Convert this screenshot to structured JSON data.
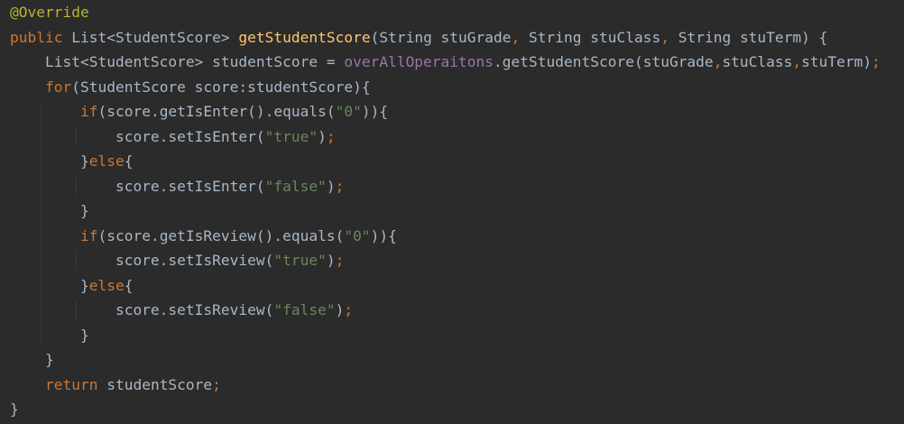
{
  "colors": {
    "background": "#2b2b2b",
    "default_text": "#a9b7c6",
    "keyword": "#cc7832",
    "annotation": "#bbb529",
    "method_declaration": "#ffc66d",
    "field": "#9876aa",
    "string": "#6a8759",
    "indent_guide": "#393939"
  },
  "code": {
    "lines": [
      {
        "tokens": [
          {
            "t": "@Override",
            "k": "annotation"
          }
        ]
      },
      {
        "tokens": [
          {
            "t": "public",
            "k": "keyword"
          },
          {
            "t": " List<StudentScore> ",
            "k": "plain"
          },
          {
            "t": "getStudentScore",
            "k": "method-decl"
          },
          {
            "t": "(String stuGrade",
            "k": "plain"
          },
          {
            "t": ", ",
            "k": "keyword"
          },
          {
            "t": "String stuClass",
            "k": "plain"
          },
          {
            "t": ", ",
            "k": "keyword"
          },
          {
            "t": "String stuTerm) {",
            "k": "plain"
          }
        ]
      },
      {
        "tokens": [
          {
            "t": "    List<StudentScore> studentScore = ",
            "k": "plain"
          },
          {
            "t": "overAllOperaitons",
            "k": "field"
          },
          {
            "t": ".getStudentScore(stuGrade",
            "k": "plain"
          },
          {
            "t": ",",
            "k": "keyword"
          },
          {
            "t": "stuClass",
            "k": "plain"
          },
          {
            "t": ",",
            "k": "keyword"
          },
          {
            "t": "stuTerm)",
            "k": "plain"
          },
          {
            "t": ";",
            "k": "keyword"
          }
        ]
      },
      {
        "tokens": [
          {
            "t": "    ",
            "k": "plain"
          },
          {
            "t": "for",
            "k": "keyword"
          },
          {
            "t": "(StudentScore score:studentScore){",
            "k": "plain"
          }
        ]
      },
      {
        "tokens": [
          {
            "t": "        ",
            "k": "plain"
          },
          {
            "t": "if",
            "k": "keyword"
          },
          {
            "t": "(score.getIsEnter().equals(",
            "k": "plain"
          },
          {
            "t": "\"0\"",
            "k": "string"
          },
          {
            "t": ")){",
            "k": "plain"
          }
        ]
      },
      {
        "tokens": [
          {
            "t": "            score.setIsEnter(",
            "k": "plain"
          },
          {
            "t": "\"true\"",
            "k": "string"
          },
          {
            "t": ")",
            "k": "plain"
          },
          {
            "t": ";",
            "k": "keyword"
          }
        ]
      },
      {
        "tokens": [
          {
            "t": "        }",
            "k": "plain"
          },
          {
            "t": "else",
            "k": "keyword"
          },
          {
            "t": "{",
            "k": "plain"
          }
        ]
      },
      {
        "tokens": [
          {
            "t": "            score.setIsEnter(",
            "k": "plain"
          },
          {
            "t": "\"false\"",
            "k": "string"
          },
          {
            "t": ")",
            "k": "plain"
          },
          {
            "t": ";",
            "k": "keyword"
          }
        ]
      },
      {
        "tokens": [
          {
            "t": "        }",
            "k": "plain"
          }
        ]
      },
      {
        "tokens": [
          {
            "t": "        ",
            "k": "plain"
          },
          {
            "t": "if",
            "k": "keyword"
          },
          {
            "t": "(score.getIsReview().equals(",
            "k": "plain"
          },
          {
            "t": "\"0\"",
            "k": "string"
          },
          {
            "t": ")){",
            "k": "plain"
          }
        ]
      },
      {
        "tokens": [
          {
            "t": "            score.setIsReview(",
            "k": "plain"
          },
          {
            "t": "\"true\"",
            "k": "string"
          },
          {
            "t": ")",
            "k": "plain"
          },
          {
            "t": ";",
            "k": "keyword"
          }
        ]
      },
      {
        "tokens": [
          {
            "t": "        }",
            "k": "plain"
          },
          {
            "t": "else",
            "k": "keyword"
          },
          {
            "t": "{",
            "k": "plain"
          }
        ]
      },
      {
        "tokens": [
          {
            "t": "            score.setIsReview(",
            "k": "plain"
          },
          {
            "t": "\"false\"",
            "k": "string"
          },
          {
            "t": ")",
            "k": "plain"
          },
          {
            "t": ";",
            "k": "keyword"
          }
        ]
      },
      {
        "tokens": [
          {
            "t": "        }",
            "k": "plain"
          }
        ]
      },
      {
        "tokens": [
          {
            "t": "    }",
            "k": "plain"
          }
        ]
      },
      {
        "tokens": [
          {
            "t": "    ",
            "k": "plain"
          },
          {
            "t": "return",
            "k": "keyword"
          },
          {
            "t": " studentScore",
            "k": "plain"
          },
          {
            "t": ";",
            "k": "keyword"
          }
        ]
      },
      {
        "tokens": [
          {
            "t": "}",
            "k": "plain"
          }
        ]
      }
    ]
  }
}
